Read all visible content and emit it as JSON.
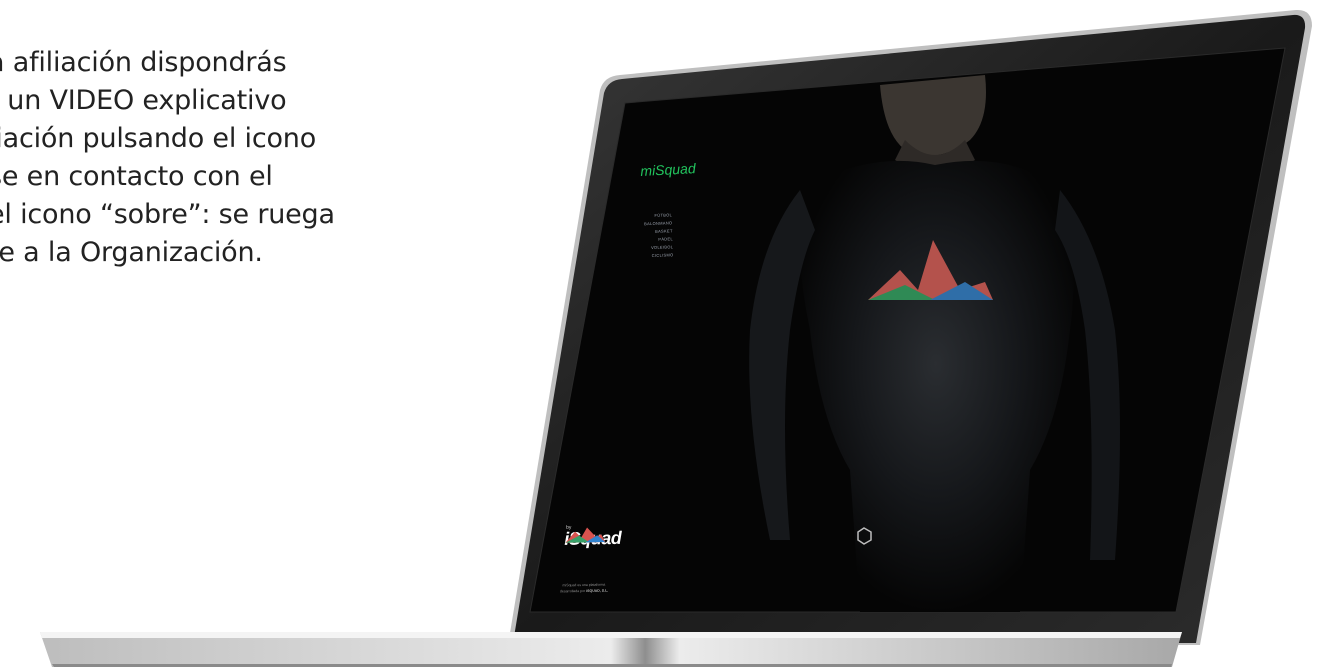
{
  "intro": {
    "lines": [
      "a afiliación dispondrás",
      "r un VIDEO explicativo",
      "liación pulsando el icono",
      "se en contacto con el",
      " el icono “sobre”:  se ruega",
      "te a la Organización."
    ]
  },
  "site": {
    "brand": "miSquad",
    "menu": [
      "FÚTBOL",
      "BALONMANO",
      "BASKET",
      "PÁDEL",
      "VOLEIBOL",
      "CICLISMO"
    ],
    "logo": {
      "by": "by",
      "name": "iSquad"
    },
    "footer": {
      "line1": "miSquad es una plataforma",
      "line2": "desarrollada por",
      "company": "iSQUAD, S.L."
    }
  },
  "colors": {
    "brand_green": "#22c55e",
    "screen_bg": "#050505",
    "bezel": "#151515",
    "laptop_base": "#d8d8d8"
  },
  "icons": {
    "hexagon": "hexagon-icon",
    "logo_mark": "mountains-logo-icon"
  }
}
